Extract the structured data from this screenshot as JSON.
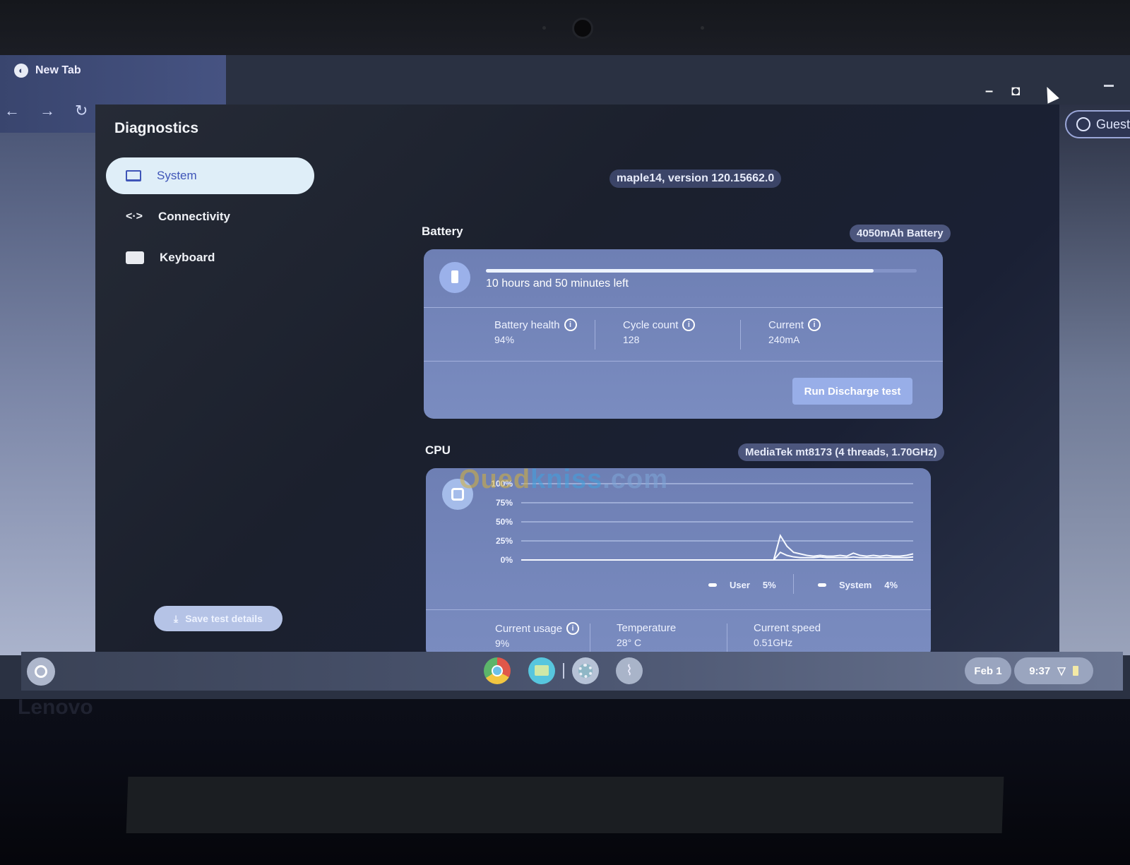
{
  "browser": {
    "tab_title": "New Tab",
    "nav": {
      "back": "←",
      "forward": "→",
      "reload": "↻"
    },
    "profile_label": "Guest"
  },
  "app": {
    "title": "Diagnostics",
    "sidebar": {
      "items": [
        {
          "label": "System",
          "icon": "laptop-icon",
          "active": true
        },
        {
          "label": "Connectivity",
          "icon": "connectivity-arrows-icon",
          "active": false
        },
        {
          "label": "Keyboard",
          "icon": "keyboard-icon",
          "active": false
        }
      ],
      "save_button": "Save test details"
    },
    "version_chip": "maple14, version 120.15662.0",
    "battery": {
      "title": "Battery",
      "chip": "4050mAh Battery",
      "charge_fraction": 0.9,
      "time_left": "10 hours and 50 minutes left",
      "stats": [
        {
          "label": "Battery health",
          "value": "94%"
        },
        {
          "label": "Cycle count",
          "value": "128"
        },
        {
          "label": "Current",
          "value": "240mA"
        }
      ],
      "run_button": "Run Discharge test"
    },
    "cpu": {
      "title": "CPU",
      "chip": "MediaTek mt8173 (4 threads, 1.70GHz)",
      "legend": [
        {
          "name": "User",
          "value": "5%"
        },
        {
          "name": "System",
          "value": "4%"
        }
      ],
      "stats": [
        {
          "label": "Current usage",
          "value": "9%"
        },
        {
          "label": "Temperature",
          "value": "28° C"
        },
        {
          "label": "Current speed",
          "value": "0.51GHz"
        }
      ]
    }
  },
  "watermark": {
    "part1": "Oued",
    "part2": "kniss",
    "part3": ".com"
  },
  "shelf": {
    "apps": [
      "chrome-icon",
      "files-icon",
      "settings-icon",
      "diagnostics-icon"
    ],
    "date": "Feb 1",
    "time": "9:37"
  },
  "bezel_brand": "Lenovo",
  "chart_data": {
    "type": "line",
    "title": "CPU",
    "xlabel": "",
    "ylabel": "",
    "ylim": [
      0,
      100
    ],
    "yticks": [
      "100%",
      "75%",
      "50%",
      "25%",
      "0%"
    ],
    "x": [
      0,
      1,
      2,
      3,
      4,
      5,
      6,
      7,
      8,
      9,
      10,
      11,
      12,
      13,
      14,
      15,
      16,
      17,
      18,
      19,
      20,
      21,
      22,
      23,
      24,
      25,
      26,
      27,
      28,
      29,
      30,
      31,
      32,
      33,
      34,
      35,
      36,
      37,
      38,
      39,
      40,
      41,
      42,
      43,
      44,
      45,
      46,
      47,
      48,
      49,
      50,
      51,
      52,
      53,
      54,
      55,
      56,
      57,
      58,
      59
    ],
    "series": [
      {
        "name": "User",
        "values": [
          0,
          0,
          0,
          0,
          0,
          0,
          0,
          0,
          0,
          0,
          0,
          0,
          0,
          0,
          0,
          0,
          0,
          0,
          0,
          0,
          0,
          0,
          0,
          0,
          0,
          0,
          0,
          0,
          0,
          0,
          0,
          0,
          0,
          0,
          0,
          0,
          0,
          0,
          0,
          32,
          18,
          10,
          8,
          6,
          5,
          6,
          5,
          5,
          6,
          5,
          9,
          6,
          5,
          6,
          5,
          6,
          5,
          5,
          6,
          8
        ]
      },
      {
        "name": "System",
        "values": [
          0,
          0,
          0,
          0,
          0,
          0,
          0,
          0,
          0,
          0,
          0,
          0,
          0,
          0,
          0,
          0,
          0,
          0,
          0,
          0,
          0,
          0,
          0,
          0,
          0,
          0,
          0,
          0,
          0,
          0,
          0,
          0,
          0,
          0,
          0,
          0,
          0,
          0,
          0,
          10,
          6,
          4,
          3,
          3,
          3,
          4,
          3,
          3,
          3,
          3,
          4,
          3,
          3,
          3,
          3,
          3,
          3,
          3,
          3,
          4
        ]
      }
    ],
    "legend_position": "bottom-right",
    "grid": true
  }
}
